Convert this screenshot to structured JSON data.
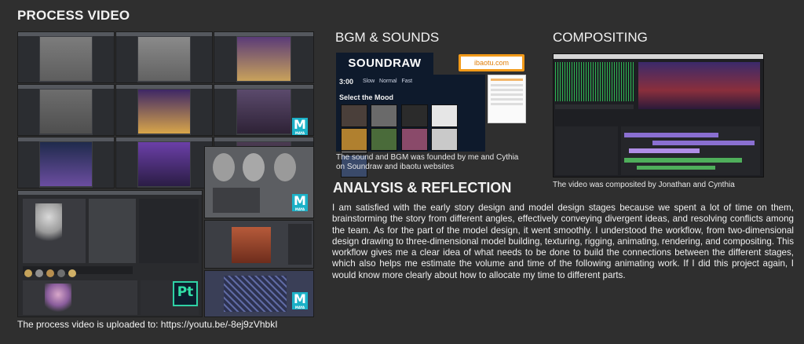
{
  "process": {
    "title": "PROCESS VIDEO",
    "caption": "The process video is uploaded to: https://youtu.be/-8ej9zVhbkI",
    "maya_badge": "M",
    "maya_badge_small": "MAYA",
    "pt_badge": "Pt"
  },
  "bgm": {
    "title": "BGM & SOUNDS",
    "soundraw_logo": "SOUNDRAW",
    "ibaotu_logo": "ibaotu.com",
    "timer": "3:00",
    "tempo_options": [
      "Slow",
      "Normal",
      "Fast"
    ],
    "mood_heading": "Select the Mood",
    "caption": "The sound and BGM was founded by me and Cythia on Soundraw and ibaotu websites"
  },
  "compositing": {
    "title": "COMPOSITING",
    "caption": "The video was composited by Jonathan and Cynthia"
  },
  "analysis": {
    "title": "ANALYSIS & REFLECTION",
    "body": "I am satisfied with the early story design and model design stages because we spent a lot of time on them, brainstorming the story from different angles, effectively conveying divergent ideas, and resolving conflicts among the team. As for the part of the model design, it went smoothly. I understood the workflow, from two-dimensional design drawing to three-dimensional model building, texturing, rigging, animating, rendering, and compositing. This workflow gives me a clear idea of what needs to be done to build the connections between the different stages, which also helps me estimate the volume and time of the following animating work. If I did this project again, I would know more clearly about how to allocate my time to different parts."
  },
  "colors": {
    "background": "#2f2f2f",
    "maya_teal": "#1bb1c7",
    "soundraw_bg": "#0e1a2c",
    "ibaotu_orange": "#f29a19",
    "timeline_purple": "#8a6fd1",
    "timeline_green": "#4fae5b",
    "purple_room": "#6b3fa8"
  },
  "icons": {
    "maya": "maya-icon",
    "substance_painter": "substance-painter-icon",
    "soundraw": "soundraw-logo",
    "ibaotu": "ibaotu-logo"
  }
}
